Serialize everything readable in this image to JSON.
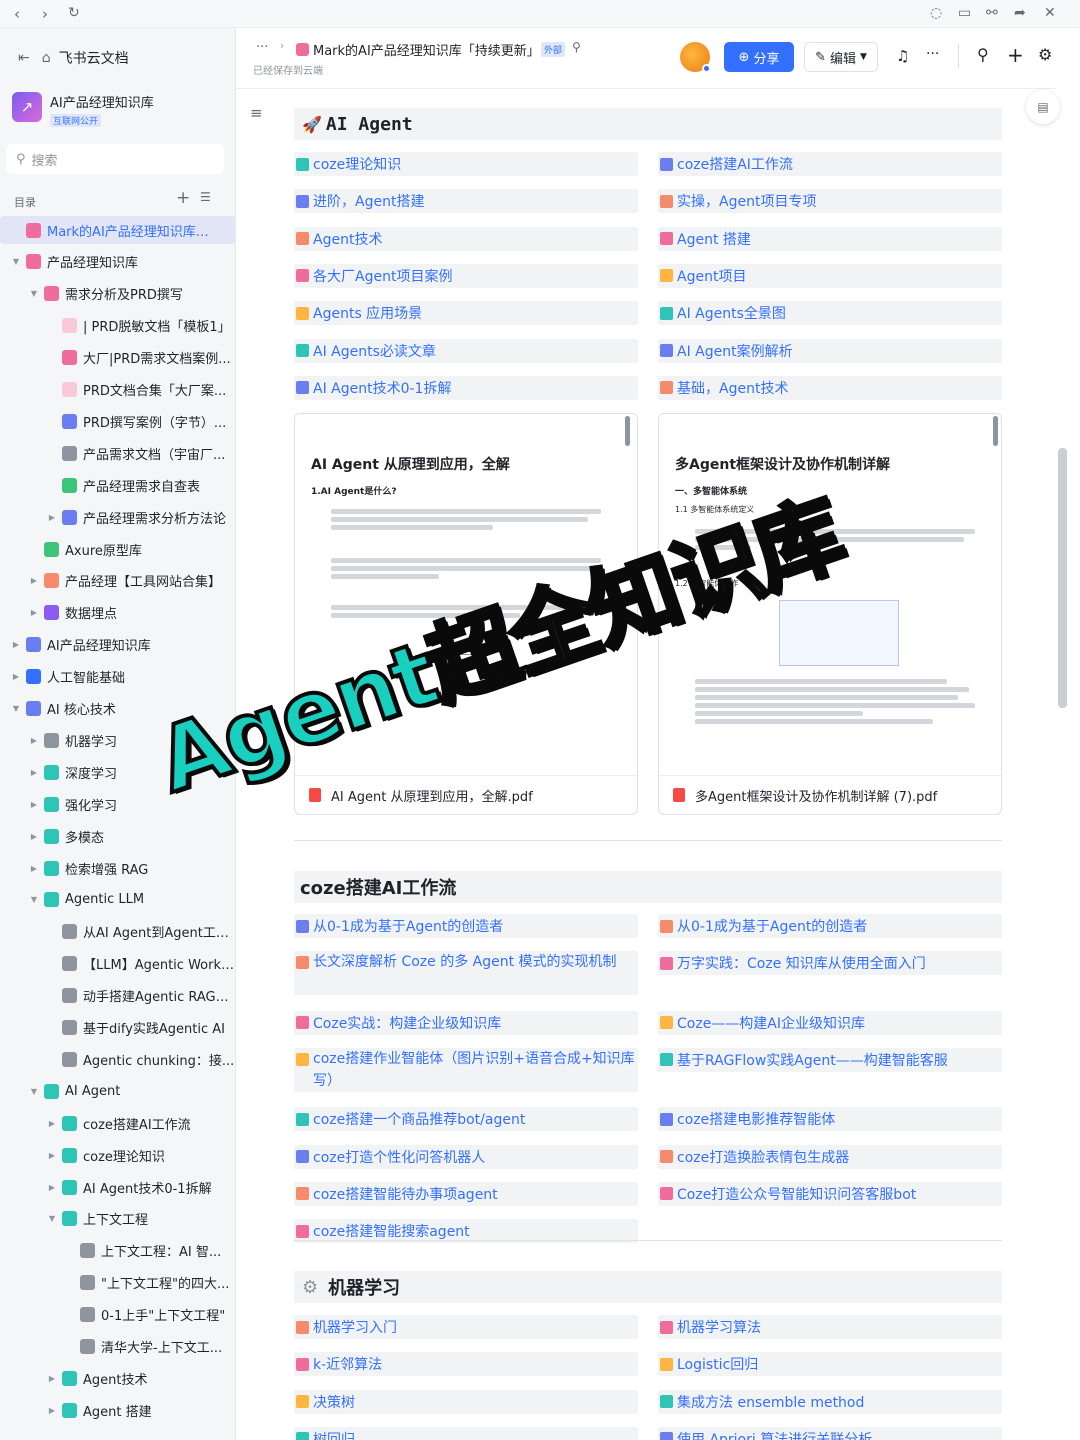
{
  "titlebar": {
    "icons": [
      "arrow-left-icon",
      "arrow-right-icon",
      "refresh-icon",
      "chat-icon",
      "window-icon",
      "link-icon",
      "share-arrow-icon",
      "close-icon"
    ]
  },
  "sidebar": {
    "app_name": "飞书云文档",
    "space_name": "AI产品经理知识库",
    "space_badge": "互联网公开",
    "search_placeholder": "搜索",
    "toc_label": "目录",
    "items": [
      {
        "label": "Mark的AI产品经理知识库「持...",
        "color": "#f06c9c",
        "level": 0,
        "arrow": "",
        "active": true
      },
      {
        "label": "产品经理知识库",
        "color": "#f06c9c",
        "level": 0,
        "arrow": "▼"
      },
      {
        "label": "需求分析及PRD撰写",
        "color": "#f06c9c",
        "level": 1,
        "arrow": "▼"
      },
      {
        "label": "| PRD脱敏文档「模板1」",
        "color": "#f9c9d9",
        "level": 2,
        "arrow": ""
      },
      {
        "label": "大厂|PRD需求文档案例...",
        "color": "#f06c9c",
        "level": 2,
        "arrow": ""
      },
      {
        "label": "PRD文档合集「大厂案...",
        "color": "#f9c9d9",
        "level": 2,
        "arrow": ""
      },
      {
        "label": "PRD撰写案例（字节）...",
        "color": "#6a7ef0",
        "level": 2,
        "arrow": ""
      },
      {
        "label": "产品需求文档（宇宙厂...",
        "color": "#8f959e",
        "level": 2,
        "arrow": ""
      },
      {
        "label": "产品经理需求自查表",
        "color": "#3ec47a",
        "level": 2,
        "arrow": ""
      },
      {
        "label": "产品经理需求分析方法论",
        "color": "#6a7ef0",
        "level": 2,
        "arrow": "▶"
      },
      {
        "label": "Axure原型库",
        "color": "#3ec47a",
        "level": 1,
        "arrow": ""
      },
      {
        "label": "产品经理【工具网站合集】",
        "color": "#f58a6c",
        "level": 1,
        "arrow": "▶"
      },
      {
        "label": "数据埋点",
        "color": "#8a5cf0",
        "level": 1,
        "arrow": "▶"
      },
      {
        "label": "AI产品经理知识库",
        "color": "#6a7ef0",
        "level": 0,
        "arrow": "▶"
      },
      {
        "label": "人工智能基础",
        "color": "#3370ff",
        "level": 0,
        "arrow": "▶"
      },
      {
        "label": "AI 核心技术",
        "color": "#6a7ef0",
        "level": 0,
        "arrow": "▼"
      },
      {
        "label": "机器学习",
        "color": "#8f959e",
        "level": 1,
        "arrow": "▶"
      },
      {
        "label": "深度学习",
        "color": "#2ec4b6",
        "level": 1,
        "arrow": "▶"
      },
      {
        "label": "强化学习",
        "color": "#2ec4b6",
        "level": 1,
        "arrow": "▶"
      },
      {
        "label": "多模态",
        "color": "#2ec4b6",
        "level": 1,
        "arrow": "▶"
      },
      {
        "label": "检索增强 RAG",
        "color": "#2ec4b6",
        "level": 1,
        "arrow": "▶"
      },
      {
        "label": "Agentic LLM",
        "color": "#2ec4b6",
        "level": 1,
        "arrow": "▼"
      },
      {
        "label": "从AI Agent到Agent工作...",
        "color": "#8f959e",
        "level": 2,
        "arrow": ""
      },
      {
        "label": "【LLM】Agentic Workfl...",
        "color": "#8f959e",
        "level": 2,
        "arrow": ""
      },
      {
        "label": "动手搭建Agentic RAG工...",
        "color": "#8f959e",
        "level": 2,
        "arrow": ""
      },
      {
        "label": "基于dify实践Agentic AI",
        "color": "#8f959e",
        "level": 2,
        "arrow": ""
      },
      {
        "label": "Agentic chunking：接...",
        "color": "#8f959e",
        "level": 2,
        "arrow": ""
      },
      {
        "label": "AI Agent",
        "color": "#2ec4b6",
        "level": 1,
        "arrow": "▼"
      },
      {
        "label": "coze搭建AI工作流",
        "color": "#2ec4b6",
        "level": 2,
        "arrow": "▶"
      },
      {
        "label": "coze理论知识",
        "color": "#2ec4b6",
        "level": 2,
        "arrow": "▶"
      },
      {
        "label": "AI Agent技术0-1拆解",
        "color": "#2ec4b6",
        "level": 2,
        "arrow": "▶"
      },
      {
        "label": "上下文工程",
        "color": "#2ec4b6",
        "level": 2,
        "arrow": "▼"
      },
      {
        "label": "上下文工程：AI 智...",
        "color": "#8f959e",
        "level": 3,
        "arrow": ""
      },
      {
        "label": "\"上下文工程\"的四大...",
        "color": "#8f959e",
        "level": 3,
        "arrow": ""
      },
      {
        "label": "0-1上手\"上下文工程\"",
        "color": "#8f959e",
        "level": 3,
        "arrow": ""
      },
      {
        "label": "清华大学-上下文工...",
        "color": "#8f959e",
        "level": 3,
        "arrow": ""
      },
      {
        "label": "Agent技术",
        "color": "#2ec4b6",
        "level": 2,
        "arrow": "▶"
      },
      {
        "label": "Agent 搭建",
        "color": "#2ec4b6",
        "level": 2,
        "arrow": "▶"
      }
    ]
  },
  "header": {
    "breadcrumb_more": "···",
    "doc_title": "Mark的AI产品经理知识库「持续更新」",
    "external_badge": "外部",
    "save_status": "已经保存到云端",
    "share_label": "分享",
    "edit_label": "编辑"
  },
  "sections": [
    {
      "title": "AI Agent",
      "links": [
        [
          "coze理论知识",
          "coze搭建AI工作流"
        ],
        [
          "进阶，Agent搭建",
          "实操，Agent项目专项"
        ],
        [
          "Agent技术",
          "Agent 搭建"
        ],
        [
          "各大厂Agent项目案例",
          "Agent项目"
        ],
        [
          "Agents 应用场景",
          "AI Agents全景图"
        ],
        [
          "AI Agents必读文章",
          "AI Agent案例解析"
        ],
        [
          "AI Agent技术0-1拆解",
          "基础，Agent技术"
        ]
      ]
    },
    {
      "title": "coze搭建AI工作流",
      "links": [
        [
          "从0-1成为基于Agent的创造者",
          "从0-1成为基于Agent的创造者"
        ],
        [
          "长文深度解析 Coze 的多 Agent 模式的实现机制",
          "万字实践：Coze 知识库从使用全面入门"
        ],
        [
          "Coze实战：构建企业级知识库",
          "Coze——构建AI企业级知识库"
        ],
        [
          "coze搭建作业智能体（图片识别+语音合成+知识库写）",
          "基于RAGFlow实践Agent——构建智能客服"
        ],
        [
          "coze搭建一个商品推荐bot/agent",
          "coze搭建电影推荐智能体"
        ],
        [
          "coze打造个性化问答机器人",
          "coze打造换脸表情包生成器"
        ],
        [
          "coze搭建智能待办事项agent",
          "Coze打造公众号智能知识问答客服bot"
        ],
        [
          "coze搭建智能搜索agent",
          ""
        ]
      ]
    },
    {
      "title": "机器学习",
      "links": [
        [
          "机器学习入门",
          "机器学习算法"
        ],
        [
          "k-近邻算法",
          "Logistic回归"
        ],
        [
          "决策树",
          "集成方法 ensemble method"
        ],
        [
          "树回归",
          "使用 Apriori 算法进行关联分析"
        ]
      ]
    }
  ],
  "pdfs": [
    {
      "filename": "AI Agent 从原理到应用，全解.pdf",
      "heading": "AI Agent 从原理到应用，全解",
      "sub": "1.AI Agent是什么?"
    },
    {
      "filename": "多Agent框架设计及协作机制详解 (7).pdf",
      "heading": "多Agent框架设计及协作机制详解",
      "sub": "一、多智能体系统",
      "sub2": "1.1 多智能体系统定义",
      "sub3": "1.2 多智能体协作"
    }
  ],
  "overlay_text": "Agent超全知识库",
  "colors": {
    "accent": "#3370ff",
    "share_button": "#3370ff",
    "overlay": "#19cfc0"
  }
}
